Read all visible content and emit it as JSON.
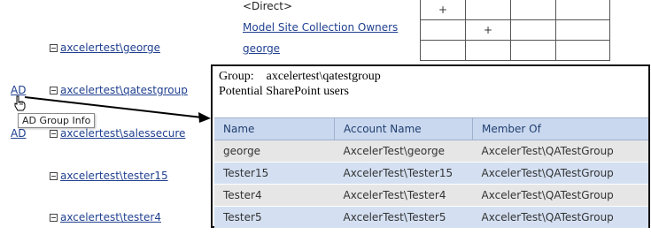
{
  "top": {
    "direct_label": "<Direct>",
    "owners_link": "Model Site Collection Owners",
    "george_link": "george",
    "grid_rows": [
      [
        "+",
        "",
        "",
        ""
      ],
      [
        "",
        "+",
        "",
        ""
      ],
      [
        "",
        "",
        "",
        ""
      ]
    ]
  },
  "tree": {
    "users": [
      {
        "label": "axcelertest\\george"
      },
      {
        "label": "axcelertest\\qatestgroup"
      },
      {
        "label": "axcelertest\\salessecure"
      },
      {
        "label": "axcelertest\\tester15"
      },
      {
        "label": "axcelertest\\tester4"
      }
    ],
    "ad_label_1": "AD",
    "ad_label_2": "AD"
  },
  "tooltip": {
    "text": "AD Group Info"
  },
  "popup": {
    "group_label": "Group:",
    "group_value": "axcelertest\\qatestgroup",
    "subtitle": "Potential SharePoint users",
    "columns": [
      "Name",
      "Account Name",
      "Member Of"
    ],
    "rows": [
      [
        "george",
        "AxcelerTest\\george",
        "AxcelerTest\\QATestGroup"
      ],
      [
        "Tester15",
        "AxcelerTest\\Tester15",
        "AxcelerTest\\QATestGroup"
      ],
      [
        "Tester4",
        "AxcelerTest\\Tester4",
        "AxcelerTest\\QATestGroup"
      ],
      [
        "Tester5",
        "AxcelerTest\\Tester5",
        "AxcelerTest\\QATestGroup"
      ]
    ]
  },
  "colors": {
    "link": "#1f3f8f",
    "header_bg": "#cad8ef",
    "row_gray": "#e6e6e6",
    "row_blue": "#d4e0f2"
  }
}
